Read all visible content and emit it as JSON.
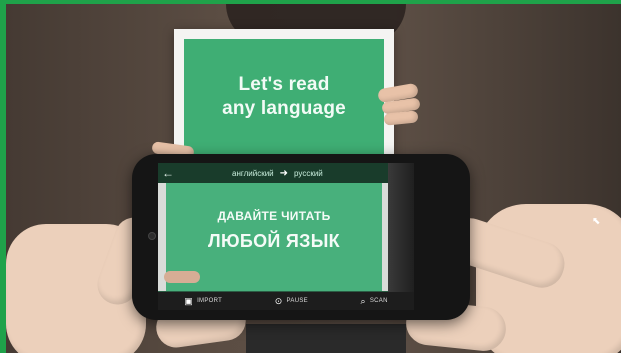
{
  "card": {
    "line1": "Let's read",
    "line2": "any language"
  },
  "app": {
    "source_language": "английский",
    "target_language": "русский",
    "translated_line1": "ДАВАЙТЕ ЧИТАТЬ",
    "translated_line2": "ЛЮБОЙ ЯЗЫК",
    "toolbar": {
      "import_label": "IMPORT",
      "pause_label": "PAUSE",
      "scan_label": "SCAN"
    },
    "icons": {
      "back": "back-arrow-icon",
      "swap": "arrow-right-icon",
      "import": "image-import-icon",
      "pause": "pause-icon",
      "scan": "search-scan-icon"
    }
  },
  "colors": {
    "frame": "#1fa24a",
    "card_green": "#3fae74",
    "screen_green": "#48b07c"
  }
}
